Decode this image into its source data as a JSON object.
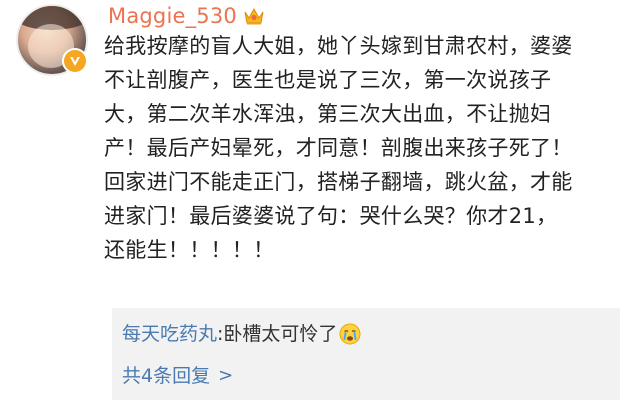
{
  "comment": {
    "username": "Maggie_530",
    "badge_icon": "crown-icon",
    "verified_icon": "verified-v-icon",
    "text_lines": [
      "给我按摩的盲人大姐，她丫头嫁到甘肃农村，婆婆",
      "不让剖腹产，医生也是说了三次，第一次说孩子",
      "大，第二次羊水浑浊，第三次大出血，不让抛妇",
      "产！最后产妇晕死，才同意！剖腹出来孩子死了！",
      "回家进门不能走正门，搭梯子翻墙，跳火盆，才能",
      "进家门！最后婆婆说了句：哭什么哭？你才21，",
      "还能生！！！！！"
    ]
  },
  "reply": {
    "user": "每天吃药丸",
    "colon": ":",
    "text": "卧槽太可怜了",
    "emoji": "crying-face-icon"
  },
  "more_replies": {
    "label": "共4条回复",
    "chevron": ">"
  },
  "colors": {
    "username": "#eb7350",
    "link_blue": "#4a7ab0",
    "reply_bg": "#f2f2f2",
    "badge_orange": "#f5a623"
  }
}
